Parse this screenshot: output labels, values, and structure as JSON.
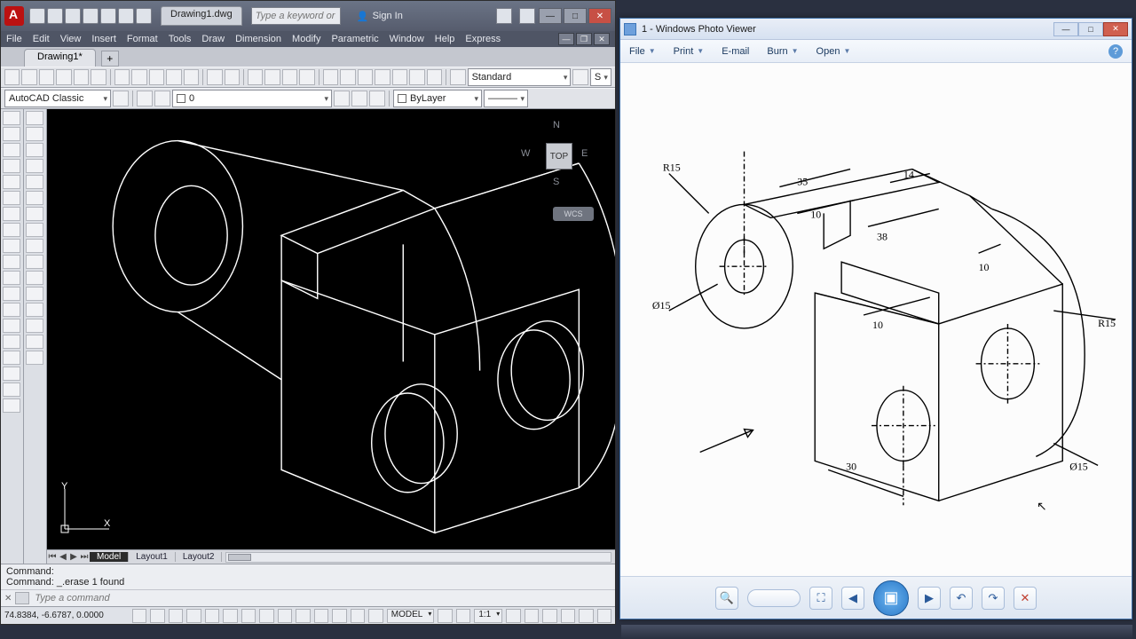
{
  "autocad": {
    "docTab": "Drawing1.dwg",
    "searchPlaceholder": "Type a keyword or phrase",
    "signIn": "Sign In",
    "menu": [
      "File",
      "Edit",
      "View",
      "Insert",
      "Format",
      "Tools",
      "Draw",
      "Dimension",
      "Modify",
      "Parametric",
      "Window",
      "Help",
      "Express"
    ],
    "fileTab": "Drawing1*",
    "workspace": "AutoCAD Classic",
    "layer": "0",
    "textStyle": "Standard",
    "lineStyle": "ByLayer",
    "viewcube": {
      "face": "TOP",
      "n": "N",
      "s": "S",
      "e": "E",
      "w": "W",
      "wcs": "WCS"
    },
    "layoutTabs": [
      "Model",
      "Layout1",
      "Layout2"
    ],
    "cmdHistory": "Command:\nCommand: _.erase 1 found",
    "cmdPlaceholder": "Type a command",
    "coords": "74.8384, -6.6787, 0.0000",
    "modelBtn": "MODEL",
    "scale": "1:1"
  },
  "photoViewer": {
    "title": "1 - Windows Photo Viewer",
    "menu": [
      "File",
      "Print",
      "E-mail",
      "Burn",
      "Open"
    ],
    "dims": {
      "R15a": "R15",
      "d35": "35",
      "d10a": "10",
      "d14": "14",
      "d38": "38",
      "d10b": "10",
      "d10c": "10",
      "phi15a": "Ø15",
      "R15b": "R15",
      "phi15b": "Ø15",
      "d30": "30"
    }
  }
}
